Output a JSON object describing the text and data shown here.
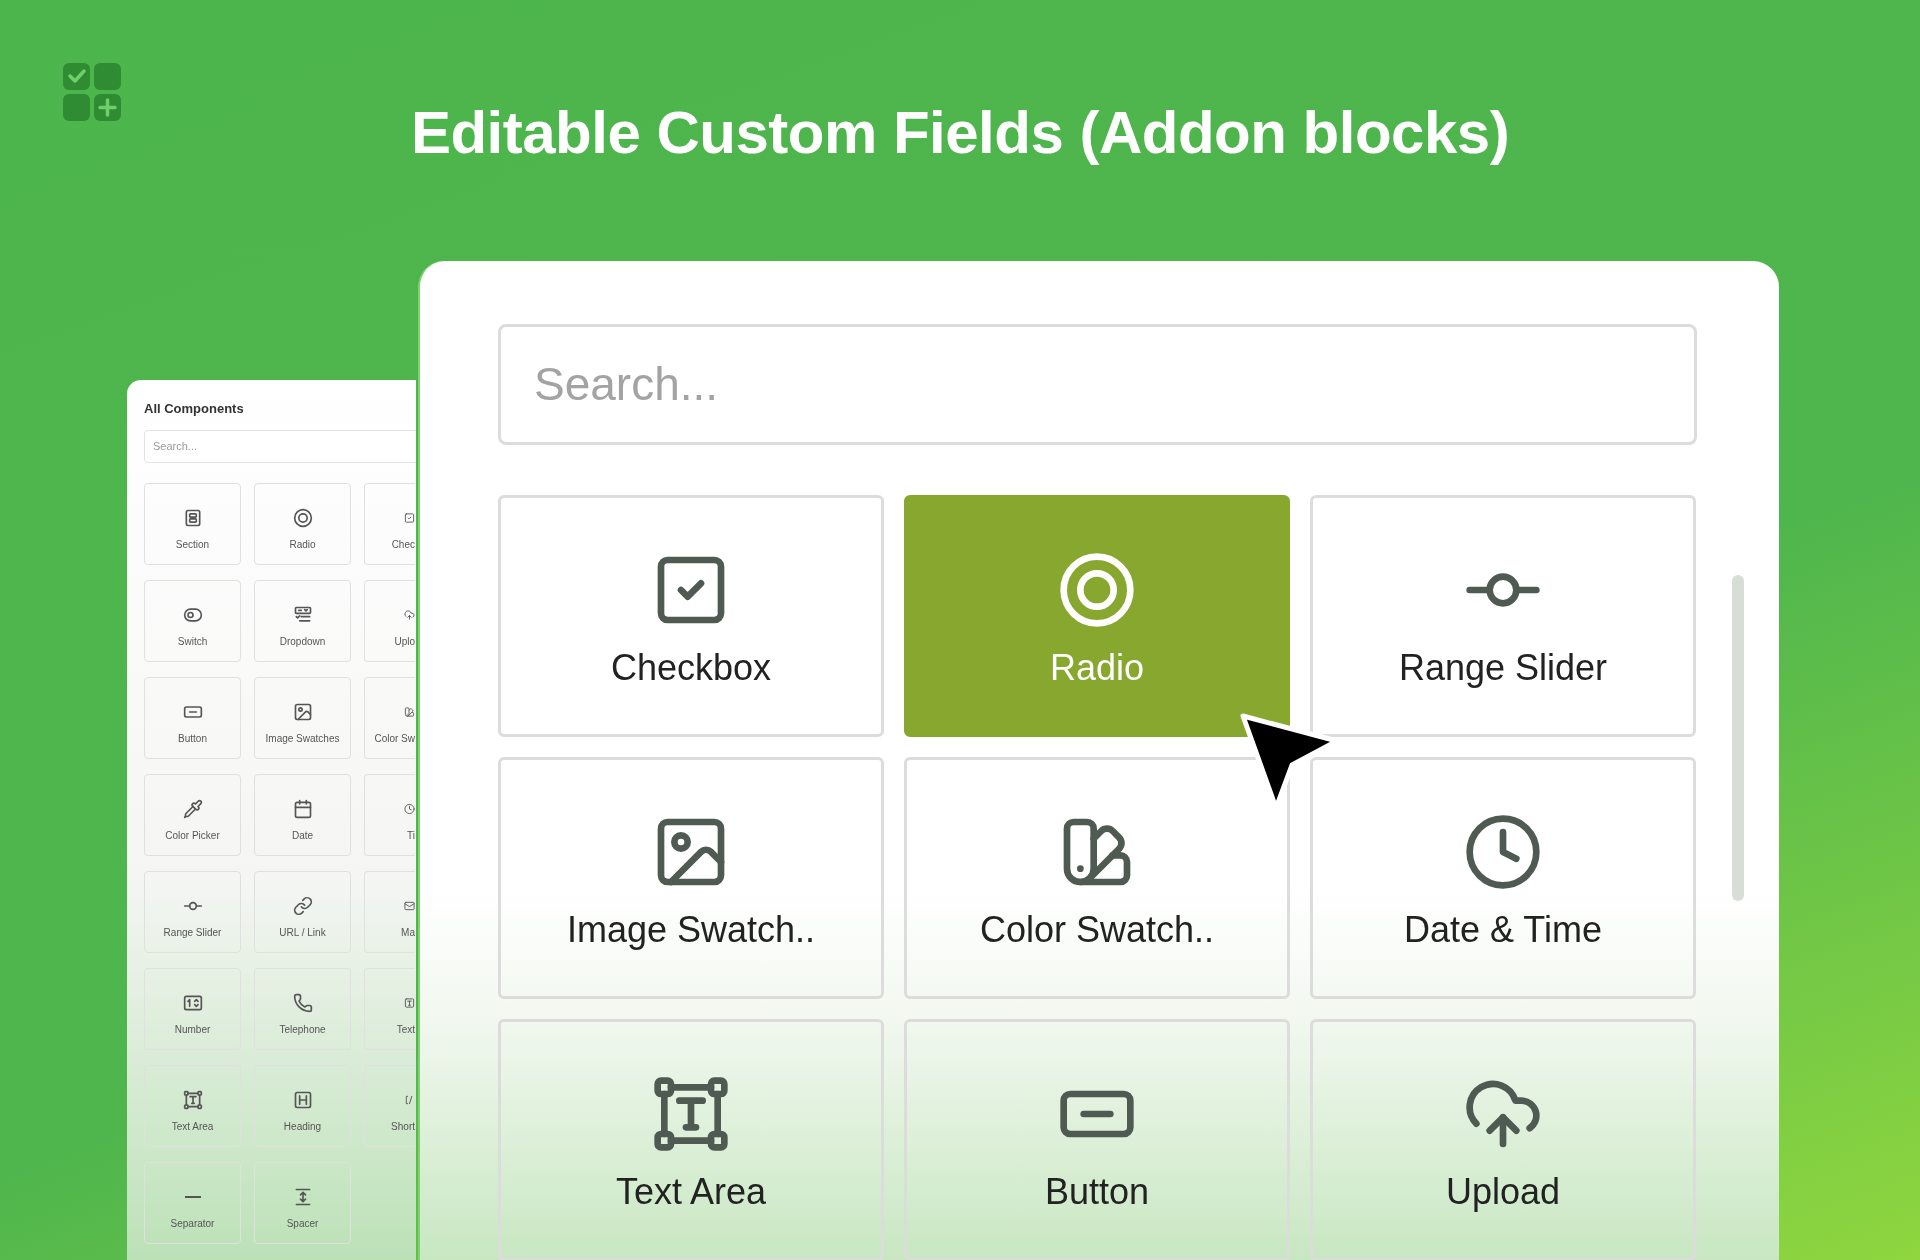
{
  "title": "Editable Custom Fields (Addon blocks)",
  "components_panel": {
    "title": "All Components",
    "search": {
      "placeholder": "Search..."
    },
    "items": [
      {
        "label": "Section",
        "kind": "section"
      },
      {
        "label": "Radio",
        "kind": "radio"
      },
      {
        "label": "Chec",
        "kind": "checkbox"
      },
      {
        "label": "Switch",
        "kind": "switch"
      },
      {
        "label": "Dropdown",
        "kind": "dropdown"
      },
      {
        "label": "Uplo",
        "kind": "upload"
      },
      {
        "label": "Button",
        "kind": "button"
      },
      {
        "label": "Image Swatches",
        "kind": "image"
      },
      {
        "label": "Color Sw",
        "kind": "swatch"
      },
      {
        "label": "Color Picker",
        "kind": "picker"
      },
      {
        "label": "Date",
        "kind": "date"
      },
      {
        "label": "Ti",
        "kind": "time"
      },
      {
        "label": "Range Slider",
        "kind": "range"
      },
      {
        "label": "URL / Link",
        "kind": "link"
      },
      {
        "label": "Ma",
        "kind": "mail"
      },
      {
        "label": "Number",
        "kind": "number"
      },
      {
        "label": "Telephone",
        "kind": "phone"
      },
      {
        "label": "Text",
        "kind": "textinput"
      },
      {
        "label": "Text Area",
        "kind": "textarea"
      },
      {
        "label": "Heading",
        "kind": "heading"
      },
      {
        "label": "Short",
        "kind": "shortcode"
      },
      {
        "label": "Separator",
        "kind": "separator"
      },
      {
        "label": "Spacer",
        "kind": "spacer"
      }
    ]
  },
  "field_picker": {
    "search": {
      "placeholder": "Search..."
    },
    "items": [
      {
        "label": "Checkbox",
        "kind": "checkbox",
        "selected": false
      },
      {
        "label": "Radio",
        "kind": "radio",
        "selected": true
      },
      {
        "label": "Range Slider",
        "kind": "range",
        "selected": false
      },
      {
        "label": "Image Swatch..",
        "kind": "image",
        "selected": false
      },
      {
        "label": "Color Swatch..",
        "kind": "swatch",
        "selected": false
      },
      {
        "label": "Date & Time",
        "kind": "time",
        "selected": false
      },
      {
        "label": "Text Area",
        "kind": "textarea",
        "selected": false
      },
      {
        "label": "Button",
        "kind": "button",
        "selected": false
      },
      {
        "label": "Upload",
        "kind": "upload",
        "selected": false
      }
    ]
  }
}
